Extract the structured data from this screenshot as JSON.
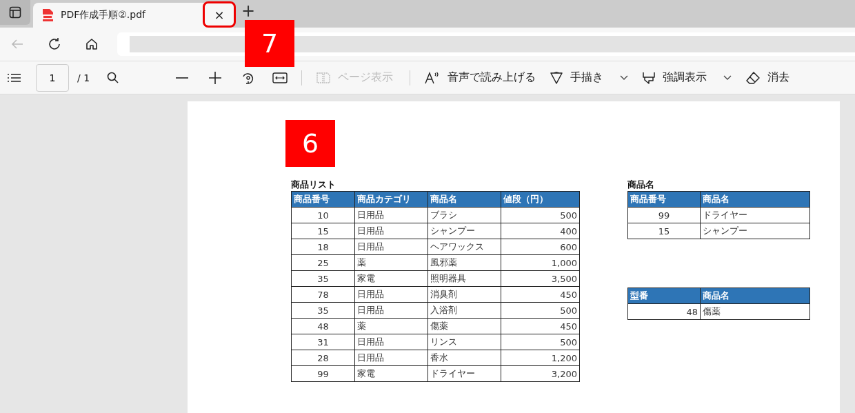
{
  "tab": {
    "title": "PDF作成手順②.pdf",
    "close": "×",
    "new_tab": "+"
  },
  "toolbar": {
    "page": "1",
    "page_total": "/ 1",
    "buttons": [
      {
        "kind": "pageview",
        "label": "ページ表示",
        "disabled": true
      },
      {
        "kind": "read",
        "label": "音声で読み上げる",
        "disabled": false
      },
      {
        "kind": "draw",
        "label": "手描き",
        "disabled": false
      },
      {
        "kind": "highlight",
        "label": "強調表示",
        "disabled": false
      },
      {
        "kind": "erase",
        "label": "消去",
        "disabled": false
      }
    ]
  },
  "callouts": [
    {
      "label": "7"
    },
    {
      "label": "6"
    }
  ],
  "tables": [
    {
      "title": "商品リスト",
      "columns": [
        {
          "label": "商品番号",
          "kind": "id"
        },
        {
          "label": "商品カテゴリ",
          "kind": "text"
        },
        {
          "label": "商品名",
          "kind": "text"
        },
        {
          "label": "値段（円）",
          "kind": "amount"
        }
      ],
      "rows": [
        [
          "10",
          "日用品",
          "ブラシ",
          "500"
        ],
        [
          "15",
          "日用品",
          "シャンプー",
          "400"
        ],
        [
          "18",
          "日用品",
          "ヘアワックス",
          "600"
        ],
        [
          "25",
          "薬",
          "風邪薬",
          "1,000"
        ],
        [
          "35",
          "家電",
          "照明器具",
          "3,500"
        ],
        [
          "78",
          "日用品",
          "消臭剤",
          "450"
        ],
        [
          "35",
          "日用品",
          "入浴剤",
          "500"
        ],
        [
          "48",
          "薬",
          "傷薬",
          "450"
        ],
        [
          "31",
          "日用品",
          "リンス",
          "500"
        ],
        [
          "28",
          "日用品",
          "香水",
          "1,200"
        ],
        [
          "99",
          "家電",
          "ドライヤー",
          "3,200"
        ]
      ]
    },
    {
      "title": "商品名",
      "columns": [
        {
          "label": "商品番号",
          "kind": "id"
        },
        {
          "label": "商品名",
          "kind": "text"
        }
      ],
      "rows": [
        [
          "99",
          "ドライヤー"
        ],
        [
          "15",
          "シャンプー"
        ]
      ]
    },
    {
      "columns": [
        {
          "label": "型番",
          "kind": "amount"
        },
        {
          "label": "商品名",
          "kind": "text"
        }
      ],
      "rows": [
        [
          "48",
          "傷薬"
        ]
      ]
    }
  ]
}
